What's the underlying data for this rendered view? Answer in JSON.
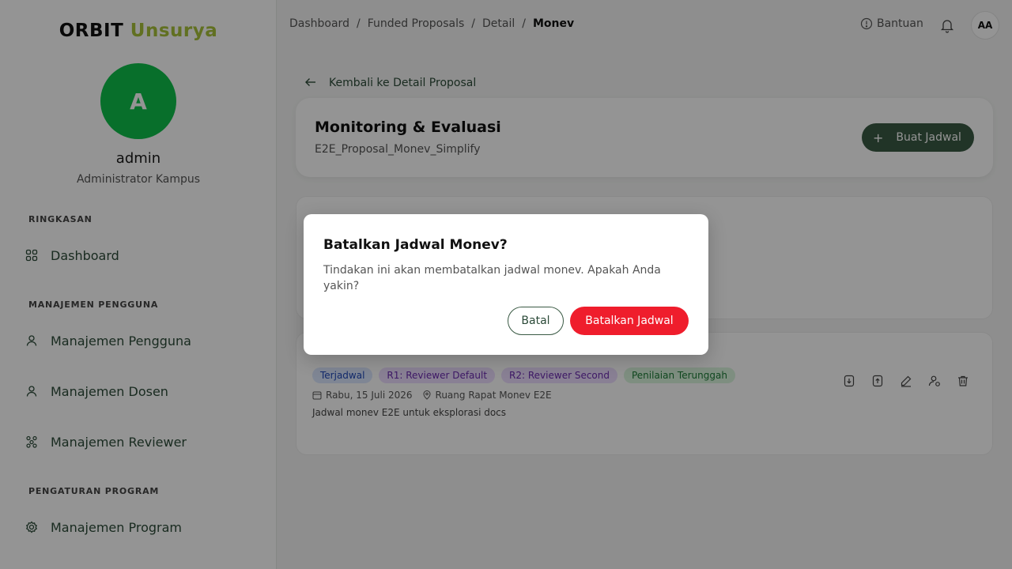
{
  "sidebar": {
    "brand_part1": "ORBIT",
    "brand_part2": "Unsurya",
    "avatar_initial": "A",
    "user_name": "admin",
    "user_role": "Administrator Kampus",
    "sections": [
      {
        "label": "RINGKASAN"
      },
      {
        "label": "MANAJEMEN PENGGUNA"
      },
      {
        "label": "PENGATURAN PROGRAM"
      }
    ],
    "items": [
      {
        "label": "Dashboard",
        "icon": "grid-icon"
      },
      {
        "label": "Manajemen Pengguna",
        "icon": "user-icon"
      },
      {
        "label": "Manajemen Dosen",
        "icon": "user-icon"
      },
      {
        "label": "Manajemen Reviewer",
        "icon": "network-icon"
      },
      {
        "label": "Manajemen Program",
        "icon": "gear-icon"
      }
    ]
  },
  "header": {
    "breadcrumb": [
      "Dashboard",
      "Funded Proposals",
      "Detail",
      "Monev"
    ],
    "separator": "/",
    "help_label": "Bantuan",
    "avatar_initials": "AA"
  },
  "main": {
    "back_label": "Kembali ke Detail Proposal",
    "title": "Monitoring & Evaluasi",
    "subtitle": "E2E_Proposal_Monev_Simplify",
    "create_button": "Buat Jadwal",
    "schedule": {
      "badges": [
        "Terjadwal",
        "R1: Reviewer Default",
        "R2: Reviewer Second",
        "Penilaian Terunggah"
      ],
      "date": "Rabu, 15 Juli 2026",
      "location": "Ruang Rapat Monev E2E",
      "description": "Jadwal monev E2E untuk eksplorasi docs"
    }
  },
  "modal": {
    "title": "Batalkan Jadwal Monev?",
    "body": "Tindakan ini akan membatalkan jadwal monev. Apakah Anda yakin?",
    "cancel_label": "Batal",
    "confirm_label": "Batalkan Jadwal"
  },
  "colors": {
    "brand_accent": "#a8c23a",
    "avatar_green": "#0fbf4a",
    "primary_dark_green": "#3a5a44",
    "danger_red": "#ef1d2c"
  }
}
